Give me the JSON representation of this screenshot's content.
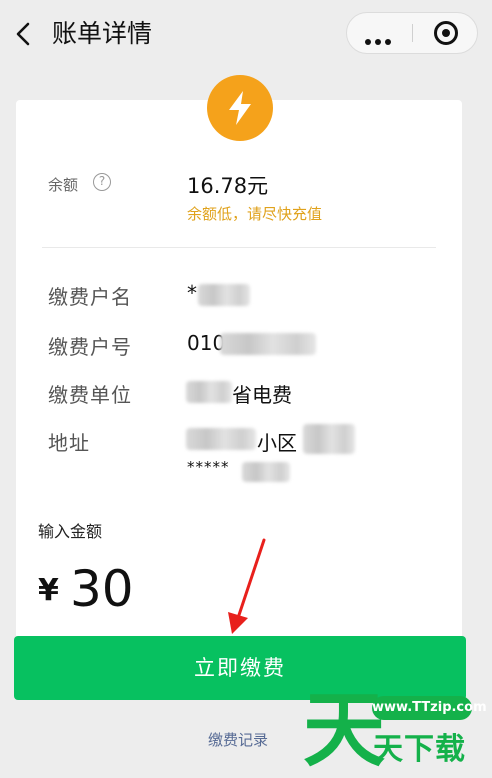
{
  "header": {
    "title": "账单详情"
  },
  "account": {
    "balance_label": "余额",
    "balance_value": "16.78元",
    "balance_warning": "余额低，请尽快充值",
    "payer_name_label": "缴费户名",
    "payer_name_value": "*",
    "account_no_label": "缴费户号",
    "account_no_value": "010",
    "unit_label": "缴费单位",
    "unit_value": "省电费",
    "address_label": "地址",
    "address_value": "小区",
    "address_mask": "*****"
  },
  "payment": {
    "amount_label": "输入金额",
    "currency_sign": "¥",
    "amount_value": "30",
    "pay_button_label": "立即缴费",
    "records_link_label": "缴费记录"
  },
  "watermark": {
    "big_char": "天",
    "url": "www.TTzip.com",
    "text": "天下载"
  },
  "colors": {
    "brand_green": "#07c160",
    "warning_orange": "#e0a21c",
    "badge_orange": "#f5a21b",
    "link_blue": "#576b95"
  },
  "icons": [
    "back-icon",
    "more-dots-icon",
    "target-icon",
    "bolt-icon",
    "help-icon",
    "arrow-icon"
  ]
}
